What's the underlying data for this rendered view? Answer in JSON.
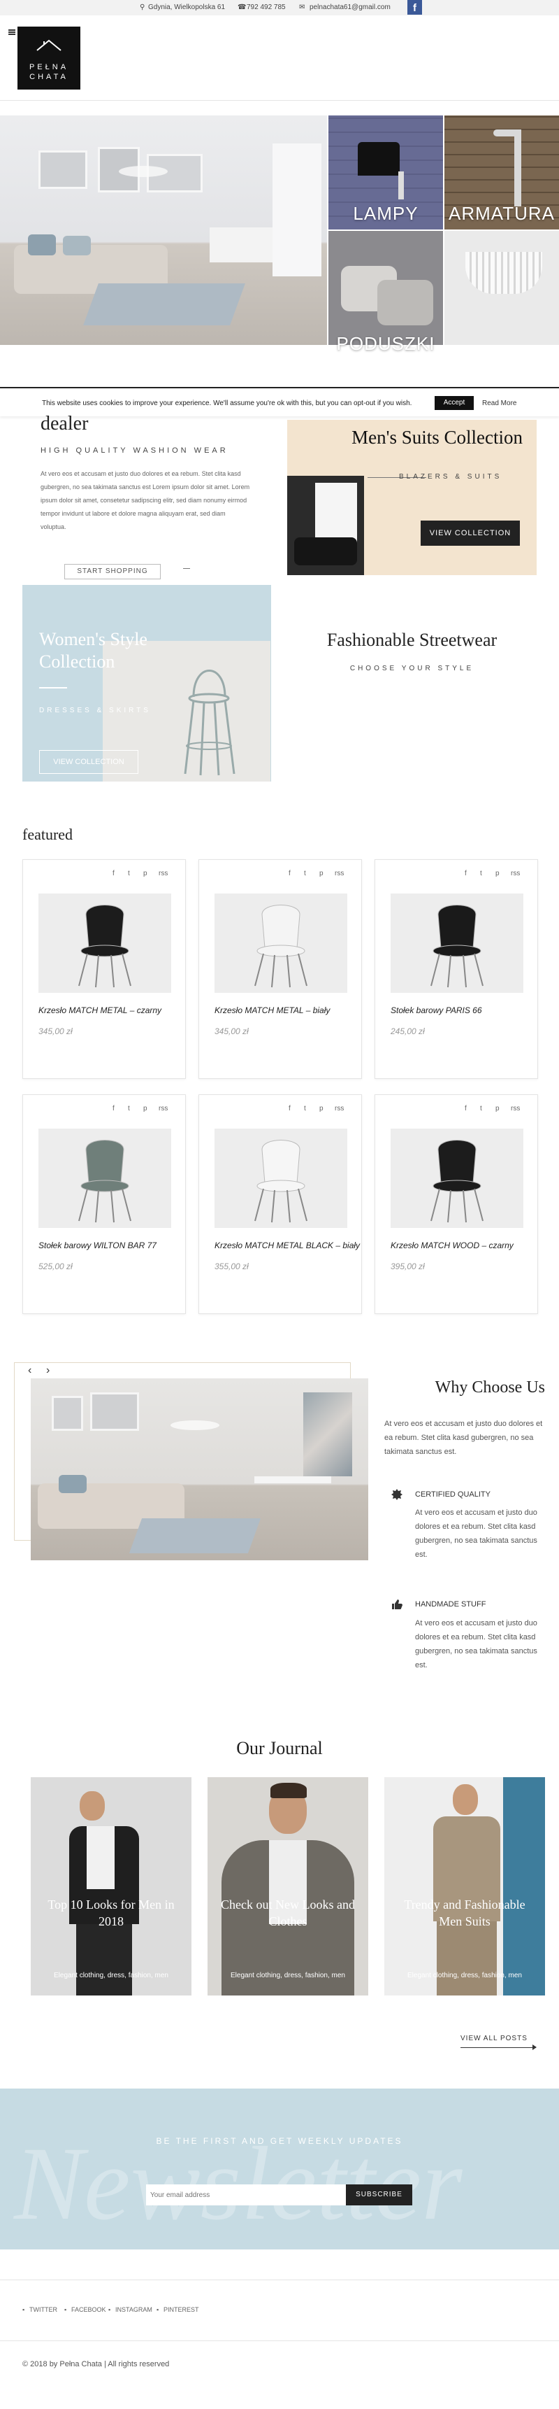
{
  "topbar": {
    "address": "Gdynia, Wielkopolska 61",
    "phone": "792 492 785",
    "email": "pelnachata61@gmail.com",
    "facebook_icon": "f"
  },
  "logo": {
    "line1": "PEŁNA",
    "line2": "CHATA"
  },
  "hero": {
    "tiles": [
      {
        "label": "LAMPY"
      },
      {
        "label": "ARMATURA"
      },
      {
        "label": "PODUSZKI"
      }
    ]
  },
  "cookie": {
    "message": "This website uses cookies to improve your experience. We'll assume you're ok with this, but you can opt-out if you wish.",
    "accept": "Accept",
    "read_more": "Read More"
  },
  "dealer": {
    "title": "dealer",
    "subtitle": "HIGH QUALITY WASHION WEAR",
    "text": "At vero eos et accusam et justo duo dolores et ea rebum. Stet clita kasd gubergren, no sea takimata sanctus est Lorem ipsum dolor sit amet. Lorem ipsum dolor sit amet, consetetur sadipscing elitr, sed diam nonumy eirmod tempor invidunt ut labore et dolore magna aliquyam erat, sed diam voluptua.",
    "button": "START SHOPPING"
  },
  "mens": {
    "title": "Men's Suits Collection",
    "subtitle": "BLAZERS & SUITS",
    "button": "VIEW COLLECTION"
  },
  "womens": {
    "title": "Women's Style Collection",
    "subtitle": "DRESSES & SKIRTS",
    "button": "VIEW COLLECTION"
  },
  "streetwear": {
    "title": "Fashionable Streetwear",
    "subtitle": "CHOOSE YOUR STYLE"
  },
  "featured": {
    "title": "featured",
    "social": [
      "f",
      "t",
      "p",
      "rss"
    ],
    "products": [
      {
        "name": "Krzesło MATCH METAL – czarny",
        "price": "345,00 zł",
        "color": "#1c1c1c"
      },
      {
        "name": "Krzesło MATCH METAL – biały",
        "price": "345,00 zł",
        "color": "#f4f4f4"
      },
      {
        "name": "Stołek barowy PARIS 66",
        "price": "245,00 zł",
        "color": "#1a1a1a"
      },
      {
        "name": "Stołek barowy WILTON BAR 77",
        "price": "525,00 zł",
        "color": "#6f7f7a"
      },
      {
        "name": "Krzesło MATCH METAL BLACK – biały",
        "price": "355,00 zł",
        "color": "#f6f6f6"
      },
      {
        "name": "Krzesło MATCH WOOD – czarny",
        "price": "395,00 zł",
        "color": "#1c1c1c"
      }
    ]
  },
  "why": {
    "title": "Why Choose Us",
    "intro": "At vero eos et accusam et justo duo dolores et ea rebum. Stet clita kasd gubergren, no sea takimata sanctus est.",
    "features": [
      {
        "title": "CERTIFIED QUALITY",
        "text": "At vero eos et accusam et justo duo dolores et ea rebum. Stet clita kasd gubergren, no sea takimata sanctus est."
      },
      {
        "title": "HANDMADE STUFF",
        "text": "At vero eos et accusam et justo duo dolores et ea rebum. Stet clita kasd gubergren, no sea takimata sanctus est."
      }
    ],
    "prev": "‹",
    "next": "›"
  },
  "journal": {
    "title": "Our Journal",
    "posts": [
      {
        "title": "Top 10 Looks for Men in 2018",
        "tags": "Elegant clothing, dress, fashion, men"
      },
      {
        "title": "Check out New Looks and Clothes",
        "tags": "Elegant clothing, dress, fashion, men"
      },
      {
        "title": "Trendy and Fashionable Men Suits",
        "tags": "Elegant clothing, dress, fashion, men"
      }
    ],
    "view_all": "VIEW ALL POSTS"
  },
  "newsletter": {
    "heading": "BE THE FIRST AND GET WEEKLY UPDATES",
    "bg_word": "Newsletter",
    "placeholder": "Your email address",
    "button": "SUBSCRIBE"
  },
  "footer": {
    "social": [
      "TWITTER",
      "FACEBOOK",
      "INSTAGRAM",
      "PINTEREST"
    ],
    "copyright": "© 2018 by Pełna Chata | All rights reserved"
  }
}
